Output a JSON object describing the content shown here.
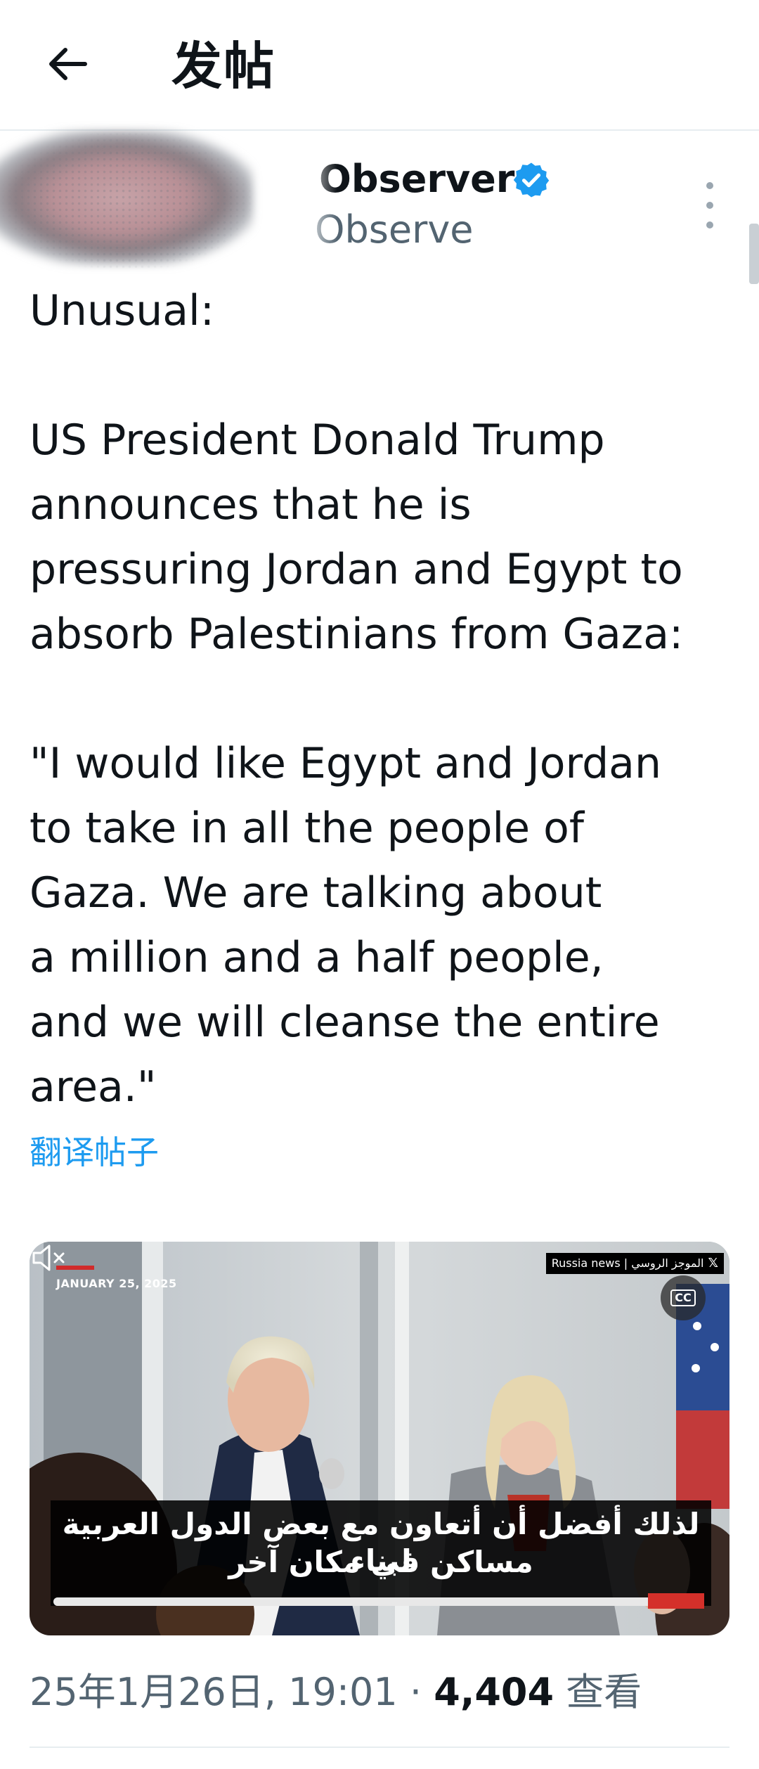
{
  "header": {
    "title": "发帖"
  },
  "author": {
    "display_name": "Observer",
    "handle": "Observe"
  },
  "tweet": {
    "text": "Unusual:\n\nUS President Donald Trump\nannounces that he is\npressuring Jordan and Egypt to\nabsorb Palestinians from Gaza:\n\n\"I would like Egypt and Jordan\nto take in all the people of\nGaza. We are talking about\na million and a half people,\nand we will cleanse the entire\narea.\"",
    "translate_label": "翻译帖子"
  },
  "media": {
    "date_label": "JANUARY 25, 2025",
    "channel_label": "Russia news | الموجز الروسي",
    "cc_label": "CC",
    "subtitle_line1": "لذلك أفضل أن أتعاون مع بعض الدول العربية لبناء",
    "subtitle_line2": "مساكن في مكان آخر",
    "progress": 0.95
  },
  "meta": {
    "timestamp": "25年1月26日, 19:01",
    "separator": "·",
    "views_count": "4,404",
    "views_label": "查看"
  },
  "colors": {
    "accent": "#1d9bf0",
    "text": "#0f1419",
    "secondary": "#536471",
    "divider": "#e7edf0"
  }
}
